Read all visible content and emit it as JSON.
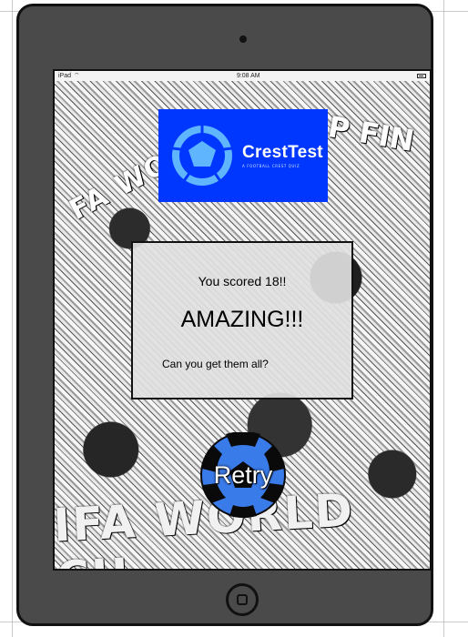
{
  "status_bar": {
    "device": "iPad",
    "time": "9:08 AM"
  },
  "background": {
    "slogan_top_left": "FA WO",
    "slogan_top_right": "P FIN",
    "slogan_bottom": "IFA WORLD CU"
  },
  "logo": {
    "title": "CrestTest",
    "tagline": "A FOOTBALL CREST QUIZ"
  },
  "result": {
    "score_text": "You scored 18!!",
    "rating": "AMAZING!!!",
    "prompt": "Can you get them all?"
  },
  "retry": {
    "label": "Retry"
  },
  "colors": {
    "logo_background": "#0037ff",
    "ball_blue": "#3a7bea",
    "frame": "#4a4a4a"
  }
}
